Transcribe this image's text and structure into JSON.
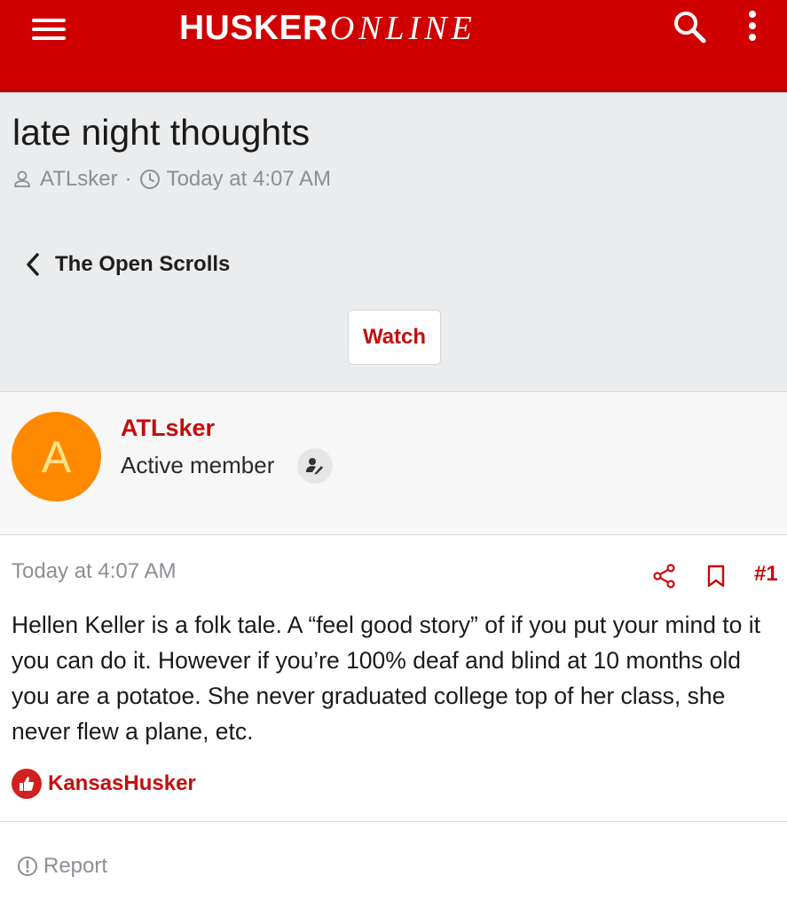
{
  "colors": {
    "brand_red": "#d00000",
    "link_red": "#c40d0d",
    "avatar_orange": "#ff8a00",
    "header_gray": "#ebeced"
  },
  "topbar": {
    "logo_bold": "HUSKER",
    "logo_italic": "ONLINE",
    "icons": [
      "menu-icon",
      "search-icon",
      "more-icon"
    ]
  },
  "thread": {
    "title": "late night thoughts",
    "author": "ATLsker",
    "separator": "·",
    "date": "Today at 4:07 AM",
    "back_label": "The Open Scrolls",
    "watch_label": "Watch"
  },
  "post": {
    "author": {
      "name": "ATLsker",
      "avatar_letter": "A",
      "title": "Active member"
    },
    "date": "Today at 4:07 AM",
    "number": "#1",
    "body": "Hellen Keller is a folk tale. A “feel good story” of if you put your mind to it you can do it. However if you’re 100% deaf and blind at 10 months old you are a potatoe. She never graduated college top of her class, she never flew a plane, etc.",
    "reaction_user": "KansasHusker",
    "report_label": "Report"
  }
}
